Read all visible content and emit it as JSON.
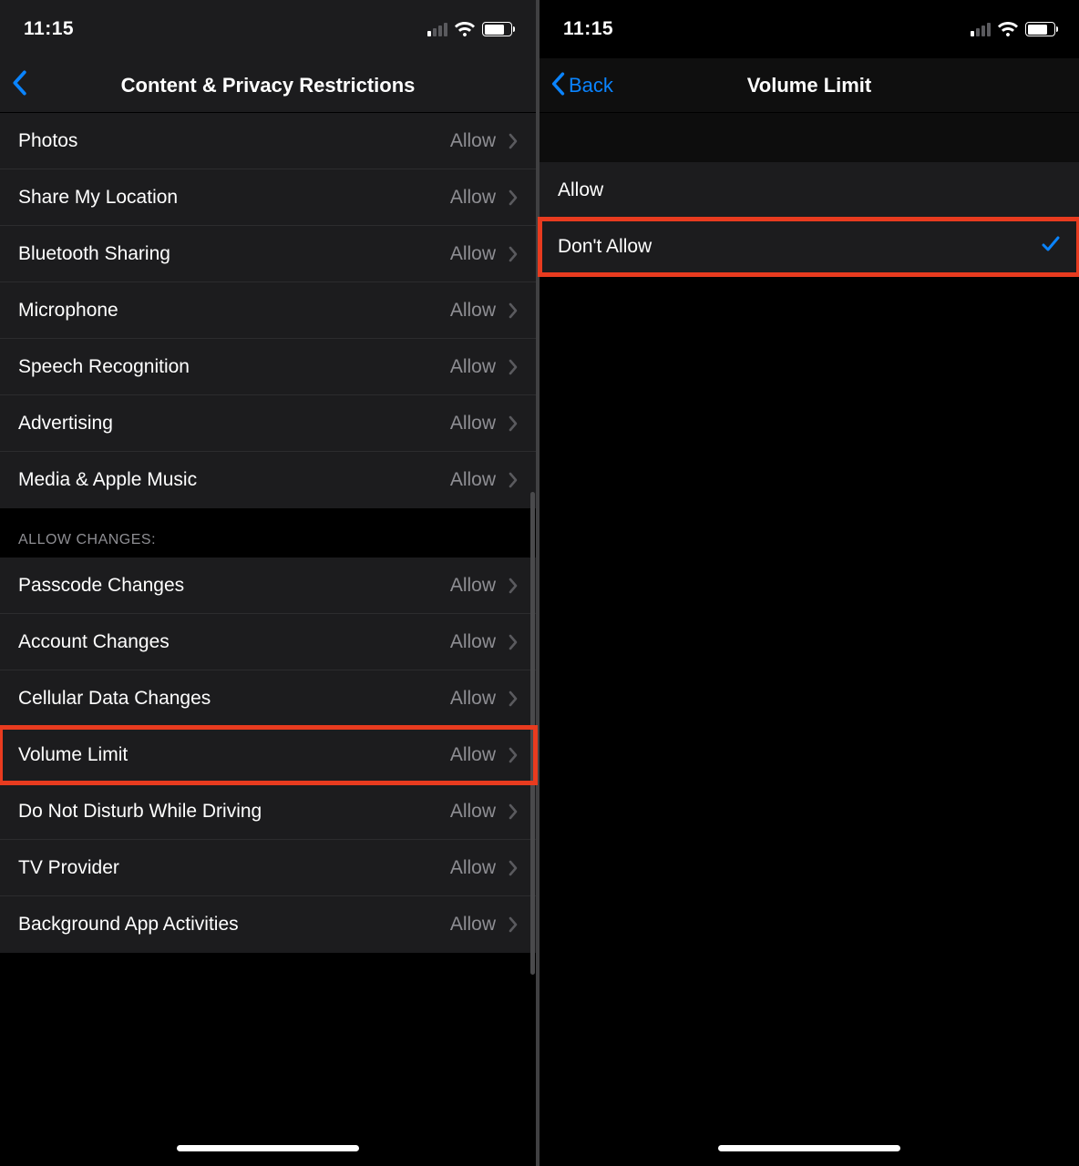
{
  "left": {
    "status": {
      "time": "11:15"
    },
    "nav": {
      "title": "Content & Privacy Restrictions"
    },
    "section1_rows": [
      {
        "label": "Photos",
        "value": "Allow"
      },
      {
        "label": "Share My Location",
        "value": "Allow"
      },
      {
        "label": "Bluetooth Sharing",
        "value": "Allow"
      },
      {
        "label": "Microphone",
        "value": "Allow"
      },
      {
        "label": "Speech Recognition",
        "value": "Allow"
      },
      {
        "label": "Advertising",
        "value": "Allow"
      },
      {
        "label": "Media & Apple Music",
        "value": "Allow"
      }
    ],
    "section2_header": "ALLOW CHANGES:",
    "section2_rows": [
      {
        "label": "Passcode Changes",
        "value": "Allow"
      },
      {
        "label": "Account Changes",
        "value": "Allow"
      },
      {
        "label": "Cellular Data Changes",
        "value": "Allow"
      },
      {
        "label": "Volume Limit",
        "value": "Allow",
        "highlighted": true
      },
      {
        "label": "Do Not Disturb While Driving",
        "value": "Allow"
      },
      {
        "label": "TV Provider",
        "value": "Allow"
      },
      {
        "label": "Background App Activities",
        "value": "Allow"
      }
    ]
  },
  "right": {
    "status": {
      "time": "11:15"
    },
    "nav": {
      "back": "Back",
      "title": "Volume Limit"
    },
    "rows": [
      {
        "label": "Allow",
        "checked": false
      },
      {
        "label": "Don't Allow",
        "checked": true,
        "highlighted": true
      }
    ]
  }
}
